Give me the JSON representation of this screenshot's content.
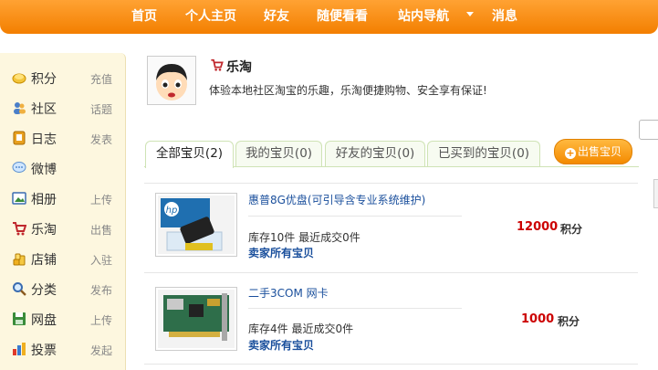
{
  "nav": {
    "items": [
      "首页",
      "个人主页",
      "好友",
      "随便看看",
      "站内导航",
      "消息"
    ]
  },
  "sidebar": {
    "items": [
      {
        "label": "积分",
        "sub": "充值",
        "icon": "coins-icon"
      },
      {
        "label": "社区",
        "sub": "话题",
        "icon": "people-icon"
      },
      {
        "label": "日志",
        "sub": "发表",
        "icon": "journal-icon"
      },
      {
        "label": "微博",
        "sub": "",
        "icon": "speech-bubble-icon"
      },
      {
        "label": "相册",
        "sub": "上传",
        "icon": "photo-icon"
      },
      {
        "label": "乐淘",
        "sub": "出售",
        "icon": "cart-icon"
      },
      {
        "label": "店铺",
        "sub": "入驻",
        "icon": "coin-stack-icon"
      },
      {
        "label": "分类",
        "sub": "发布",
        "icon": "magnifier-icon"
      },
      {
        "label": "网盘",
        "sub": "上传",
        "icon": "disk-icon"
      },
      {
        "label": "投票",
        "sub": "发起",
        "icon": "bar-chart-icon"
      }
    ]
  },
  "profile": {
    "title": "乐淘",
    "description": "体验本地社区淘宝的乐趣，乐淘便捷购物、安全享有保证!"
  },
  "tabs": [
    "全部宝贝(2)",
    "我的宝贝(0)",
    "好友的宝贝(0)",
    "已买到的宝贝(0)"
  ],
  "sell_button": "出售宝贝",
  "items": [
    {
      "name": "惠普8G优盘(可引导含专业系统维护)",
      "stock": "库存10件  最近成交0件",
      "seller": "卖家所有宝贝",
      "price": "12000",
      "unit": "积分"
    },
    {
      "name": "二手3COM 网卡",
      "stock": "库存4件  最近成交0件",
      "seller": "卖家所有宝贝",
      "price": "1000",
      "unit": "积分"
    }
  ],
  "colors": {
    "accent": "#f48a00",
    "price": "#cc0000",
    "link": "#1a4f9c"
  }
}
